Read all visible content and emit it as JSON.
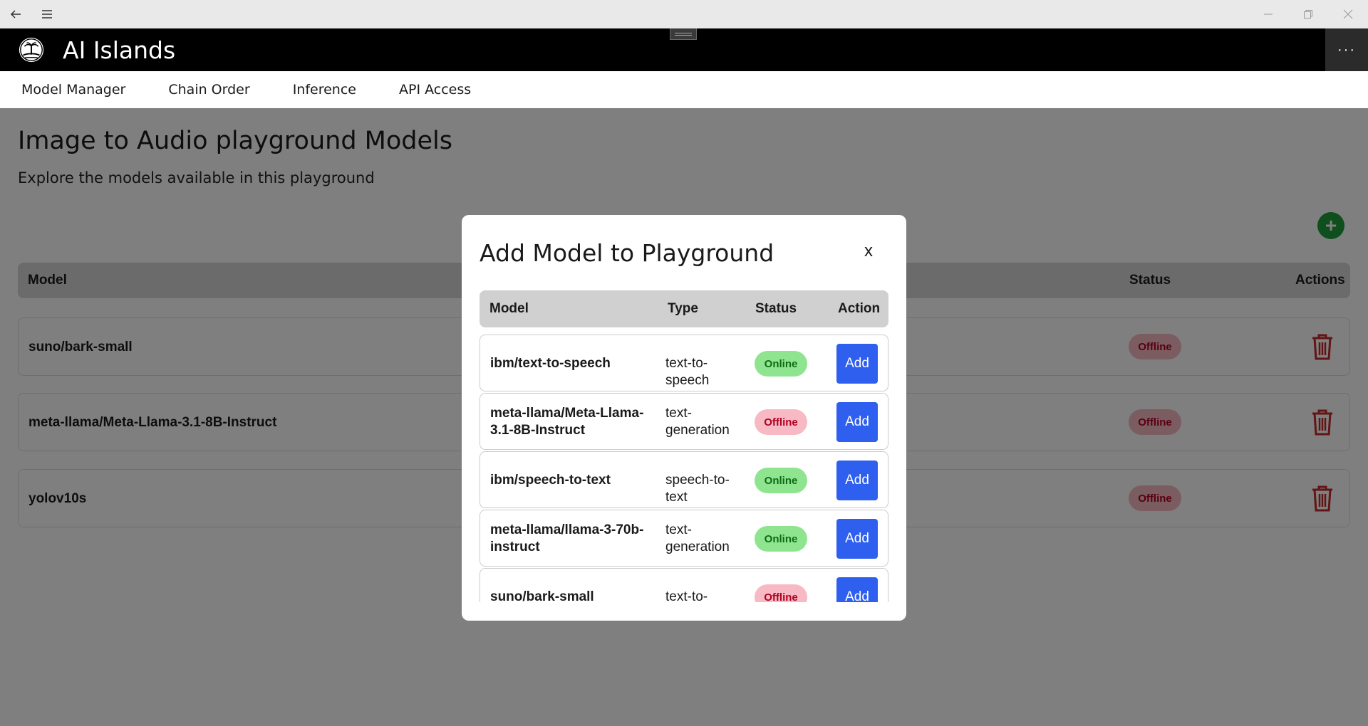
{
  "app": {
    "title": "AI Islands"
  },
  "nav": [
    "Model Manager",
    "Chain Order",
    "Inference",
    "API Access"
  ],
  "page": {
    "title": "Image to Audio playground Models",
    "subtitle": "Explore the models available in this playground",
    "table_headers": {
      "model": "Model",
      "status": "Status",
      "actions": "Actions"
    },
    "rows": [
      {
        "model": "suno/bark-small",
        "status": "Offline"
      },
      {
        "model": "meta-llama/Meta-Llama-3.1-8B-Instruct",
        "status": "Offline"
      },
      {
        "model": "yolov10s",
        "status": "Offline"
      }
    ]
  },
  "modal": {
    "title": "Add Model to Playground",
    "close_label": "x",
    "headers": {
      "model": "Model",
      "type": "Type",
      "status": "Status",
      "action": "Action"
    },
    "rows": [
      {
        "model": "ibm/text-to-speech",
        "type": "text-to-speech",
        "status": "Online",
        "action": "Add"
      },
      {
        "model": "meta-llama/Meta-Llama-3.1-8B-Instruct",
        "type": "text-generation",
        "status": "Offline",
        "action": "Add"
      },
      {
        "model": "ibm/speech-to-text",
        "type": "speech-to-text",
        "status": "Online",
        "action": "Add"
      },
      {
        "model": "meta-llama/llama-3-70b-instruct",
        "type": "text-generation",
        "status": "Online",
        "action": "Add"
      },
      {
        "model": "suno/bark-small",
        "type": "text-to-speech",
        "status": "Offline",
        "action": "Add"
      }
    ]
  },
  "icons": {
    "back": "back-arrow-icon",
    "menu": "hamburger-menu-icon",
    "minimize": "minimize-icon",
    "restore": "restore-icon",
    "close": "close-icon",
    "logo": "island-logo-icon",
    "more": "more-options-icon",
    "add": "plus-icon",
    "delete": "trash-icon"
  },
  "colors": {
    "online_bg": "#8fe58f",
    "offline_bg": "#f7b9c3",
    "add_button": "#2f5fef",
    "fab": "#1f9d3b",
    "trash": "#c62828"
  }
}
